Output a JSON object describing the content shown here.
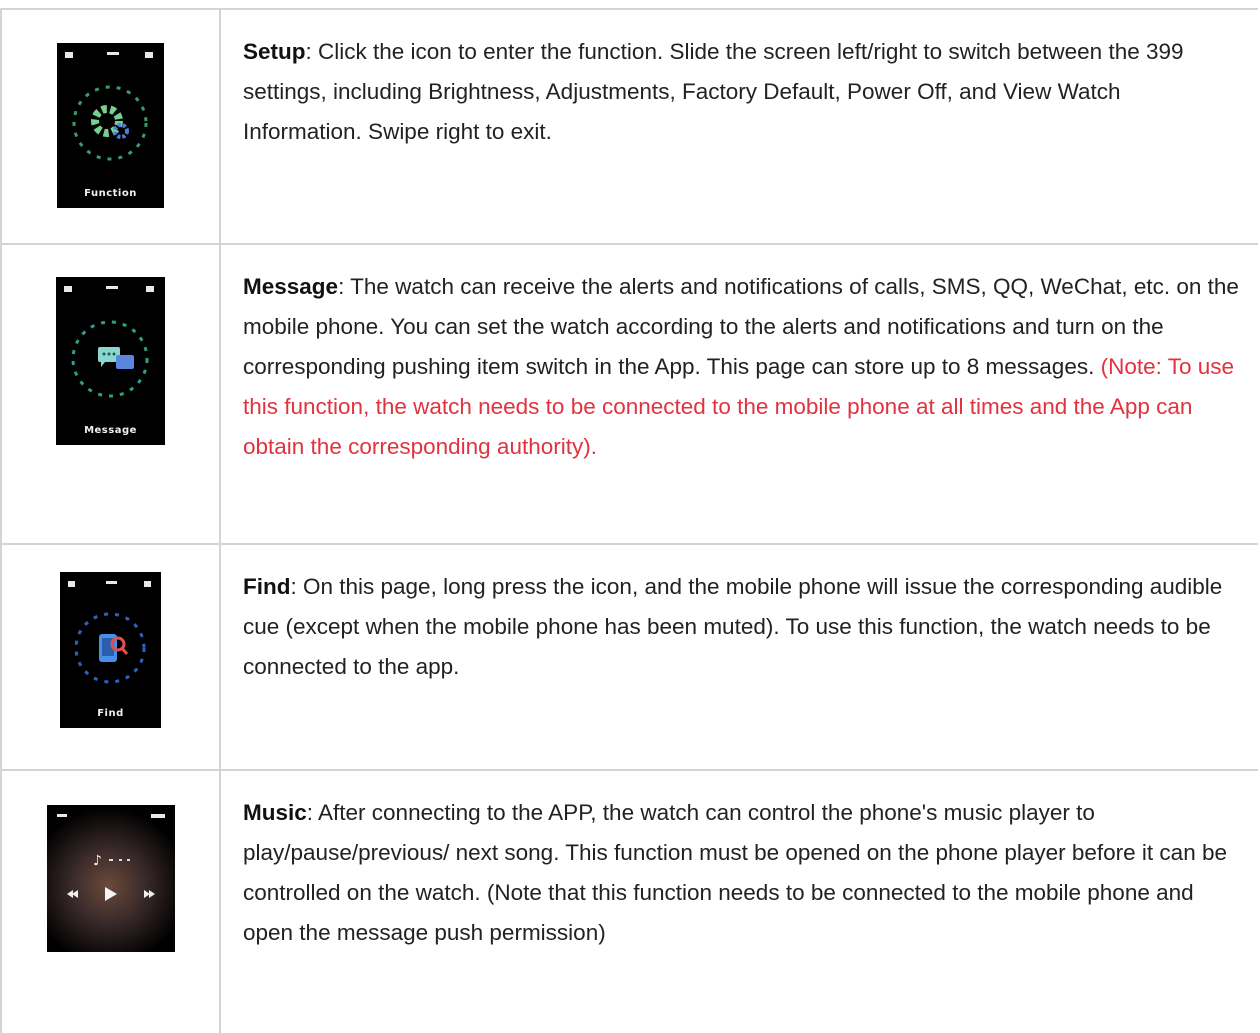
{
  "rows": [
    {
      "icon": "gear-icon",
      "title": "Setup",
      "text": ": Click the icon to enter the function. Slide the screen left/right to switch between the 399 settings, including Brightness, Adjustments, Factory Default, Power Off, and View Watch Information. Swipe right to exit.",
      "note": "",
      "caption": "Function",
      "accent": "#5fbf8a"
    },
    {
      "icon": "message-icon",
      "title": "Message",
      "text": ": The watch can receive the alerts and notifications of calls, SMS, QQ, WeChat, etc. on the mobile phone. You can set the watch according to the alerts and notifications and turn on the corresponding pushing item switch in the App. This page can store up to 8 messages. ",
      "note": "(Note: To use this function, the watch needs to be connected to the mobile phone at all times and the App can obtain the corresponding authority).",
      "caption": "Message",
      "accent": "#3fb6a8"
    },
    {
      "icon": "find-phone-icon",
      "title": "Find",
      "text": ": On this page, long press the icon, and the mobile phone will issue the corresponding audible cue (except when the mobile phone has been muted). To use this function, the watch needs to be connected to the app.",
      "note": "",
      "caption": "Find",
      "accent": "#3f7fd6"
    },
    {
      "icon": "music-icon",
      "title": "Music",
      "text": ": After connecting to the APP, the watch can control the phone's music player to play/pause/previous/ next song. This function must be opened on the phone player before it can be controlled on the watch. (Note that this function needs to be connected to the mobile phone and open the message push permission)",
      "note": "",
      "caption": "",
      "accent": "#b07a5a"
    }
  ]
}
